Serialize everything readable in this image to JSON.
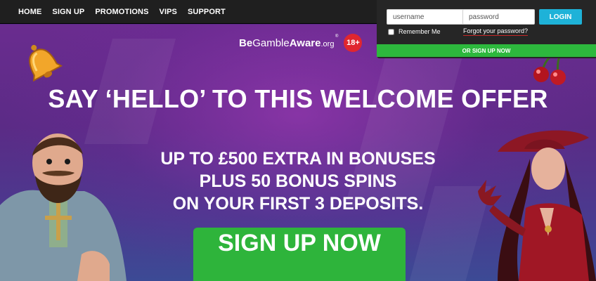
{
  "nav": {
    "items": [
      "HOME",
      "SIGN UP",
      "PROMOTIONS",
      "VIPS",
      "SUPPORT"
    ]
  },
  "login": {
    "username_placeholder": "username",
    "password_placeholder": "password",
    "login_label": "LOGIN",
    "remember_label": "Remember Me",
    "forgot_label": "Forgot your password?",
    "or_signup_label": "OR SIGN UP NOW"
  },
  "gamble_aware": {
    "logo_bold": "Be",
    "logo_mid": "Gamble",
    "logo_bold2": "Aware",
    "logo_suffix": ".org",
    "registered": "®",
    "age_badge": "18+"
  },
  "hero": {
    "headline": "SAY ‘HELLO’ TO THIS WELCOME OFFER",
    "offer_lines": [
      "UP TO £500 EXTRA IN BONUSES",
      "PLUS 50 BONUS SPINS",
      "ON YOUR FIRST 3 DEPOSITS."
    ],
    "cta_label": "SIGN UP NOW"
  },
  "colors": {
    "nav_bg": "#1f1f1f",
    "login_button": "#1eb2d8",
    "signup_green": "#2eb43b",
    "age_badge_red": "#e0262f",
    "hero_purple": "#5b2b86"
  },
  "icons": {
    "bell": "bell-icon",
    "cherries": "cherries-icon",
    "dwarf": "dwarf-character-illustration",
    "lady": "red-lady-character-illustration"
  }
}
